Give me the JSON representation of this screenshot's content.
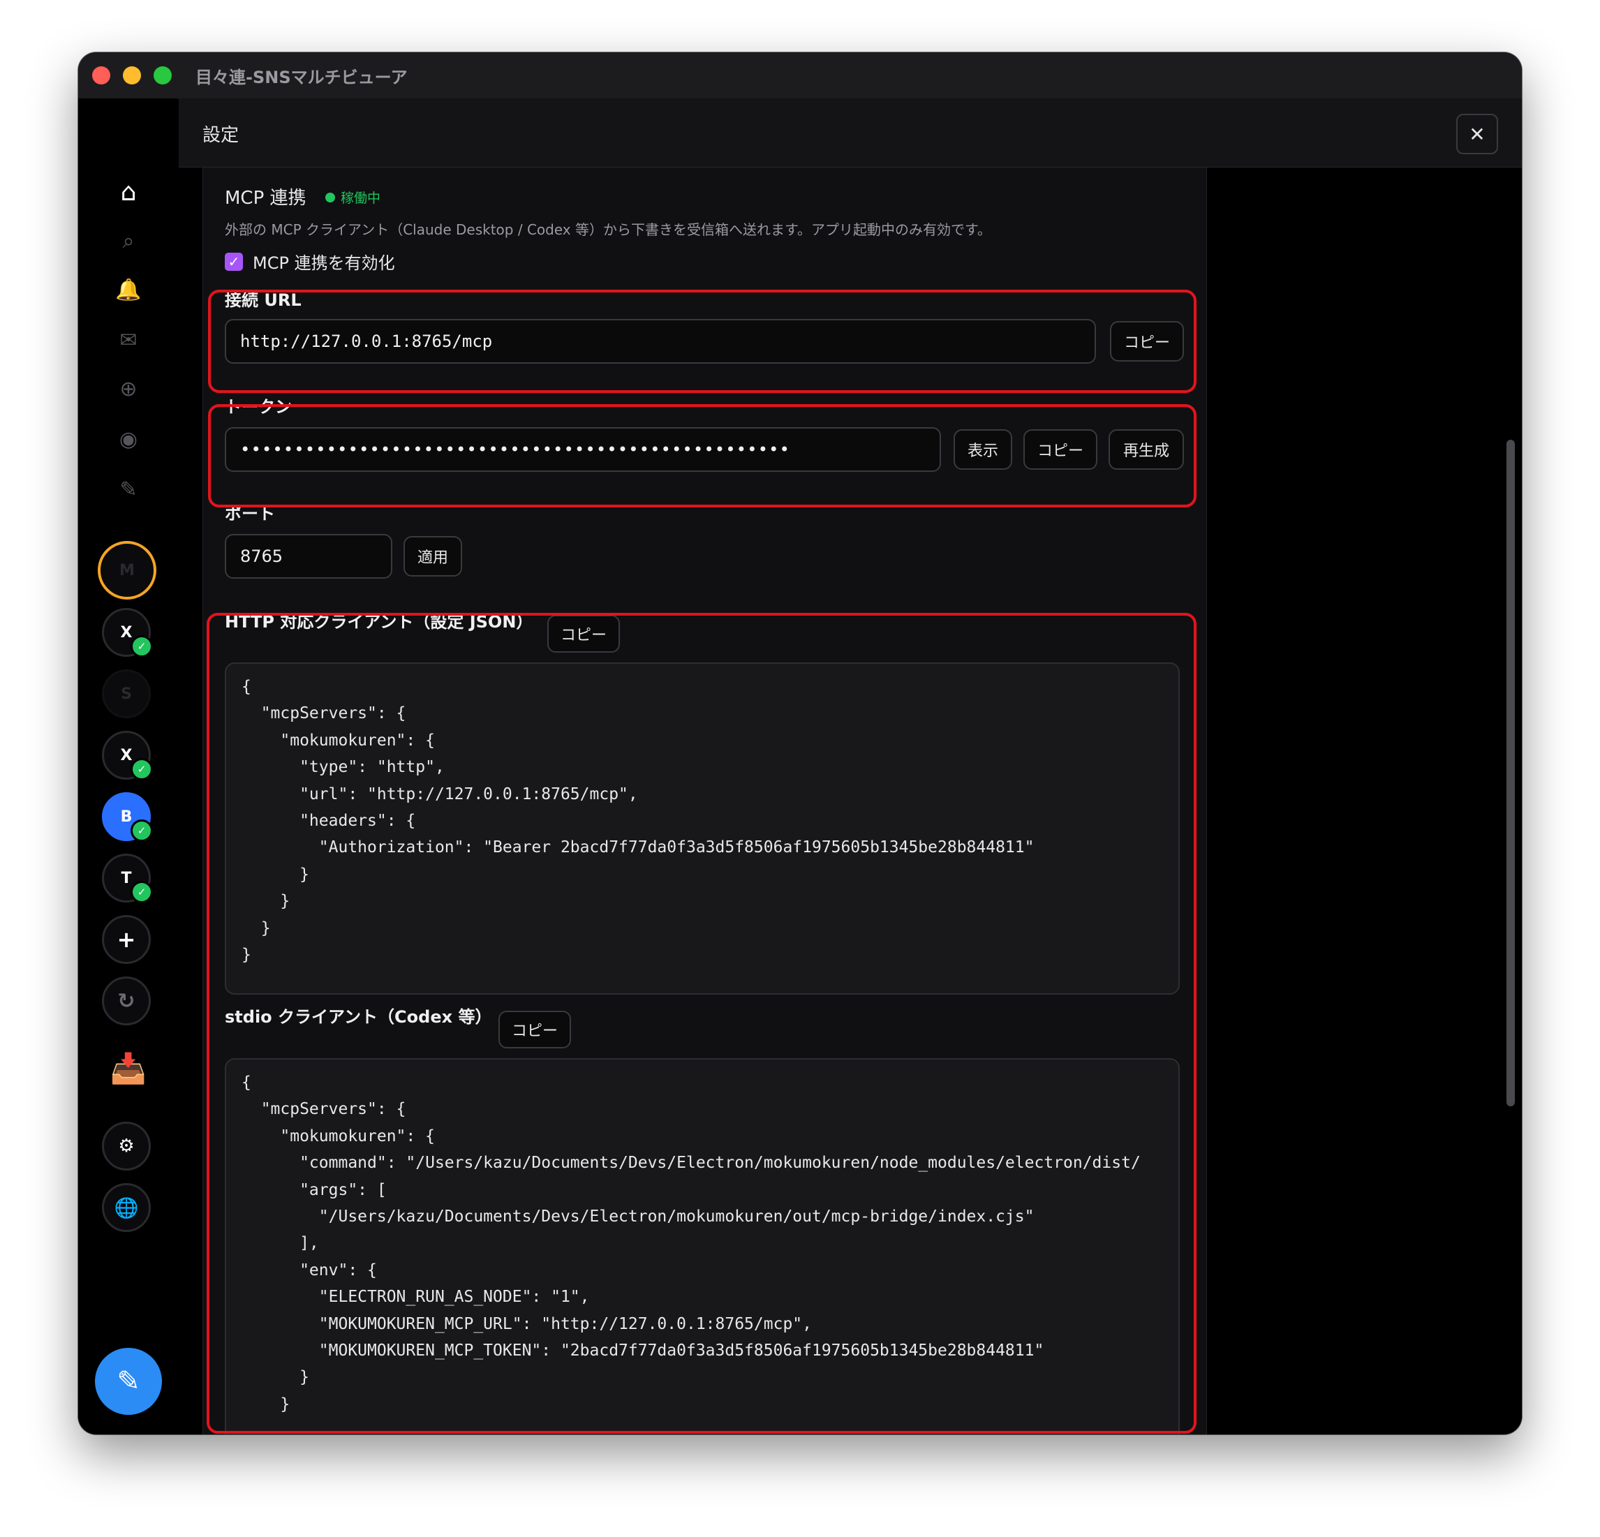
{
  "window": {
    "title": "目々連-SNSマルチビューア"
  },
  "sidebar": {
    "icons": [
      {
        "name": "home-icon",
        "glyph": "⌂"
      },
      {
        "name": "search-icon",
        "glyph": "⌕"
      },
      {
        "name": "bell-icon",
        "glyph": "🔔"
      },
      {
        "name": "mail-icon",
        "glyph": "✉"
      },
      {
        "name": "add-circle-icon",
        "glyph": "⊕"
      },
      {
        "name": "record-icon",
        "glyph": "◉"
      },
      {
        "name": "pencil-icon",
        "glyph": "✎"
      }
    ],
    "accounts": [
      {
        "label": "M",
        "status": "active"
      },
      {
        "label": "X",
        "verified": "✓"
      },
      {
        "label": "S",
        "status": "dim"
      },
      {
        "label": "X",
        "verified": "✓"
      },
      {
        "label": "B",
        "verified": "✓"
      },
      {
        "label": "T",
        "verified": "✓"
      }
    ],
    "add_glyph": "+",
    "refresh_glyph": "↻",
    "inbox_glyph": "📥",
    "settings_glyph": "⚙",
    "globe_glyph": "🌐",
    "compose_glyph": "✎"
  },
  "settings": {
    "title": "設定",
    "close_glyph": "✕",
    "mcp": {
      "title": "MCP 連携",
      "status": "稼働中",
      "description": "外部の MCP クライアント（Claude Desktop / Codex 等）から下書きを受信箱へ送れます。アプリ起動中のみ有効です。",
      "enable_label": "MCP 連携を有効化",
      "checkbox_glyph": "✓",
      "url_label": "接続 URL",
      "url_value": "http://127.0.0.1:8765/mcp",
      "copy": "コピー",
      "token_label": "トークン",
      "token_masked": "•••••••••••••••••••••••••••••••••••••••••••••••••••",
      "show": "表示",
      "regenerate": "再生成",
      "port_label": "ポート",
      "port_value": "8765",
      "apply": "適用",
      "http_title": "HTTP 対応クライアント（設定 JSON）",
      "http_json": "{\n  \"mcpServers\": {\n    \"mokumokuren\": {\n      \"type\": \"http\",\n      \"url\": \"http://127.0.0.1:8765/mcp\",\n      \"headers\": {\n        \"Authorization\": \"Bearer 2bacd7f77da0f3a3d5f8506af1975605b1345be28b844811\"\n      }\n    }\n  }\n}",
      "stdio_title": "stdio クライアント（Codex 等）",
      "stdio_json": "{\n  \"mcpServers\": {\n    \"mokumokuren\": {\n      \"command\": \"/Users/kazu/Documents/Devs/Electron/mokumokuren/node_modules/electron/dist/\n      \"args\": [\n        \"/Users/kazu/Documents/Devs/Electron/mokumokuren/out/mcp-bridge/index.cjs\"\n      ],\n      \"env\": {\n        \"ELECTRON_RUN_AS_NODE\": \"1\",\n        \"MOKUMOKUREN_MCP_URL\": \"http://127.0.0.1:8765/mcp\",\n        \"MOKUMOKUREN_MCP_TOKEN\": \"2bacd7f77da0f3a3d5f8506af1975605b1345be28b844811\"\n      }\n    }"
    }
  },
  "colors": {
    "highlight": "#e3141c",
    "status_green": "#22c55e",
    "checkbox_purple": "#a855f7",
    "compose_blue": "#2b8cf5"
  }
}
